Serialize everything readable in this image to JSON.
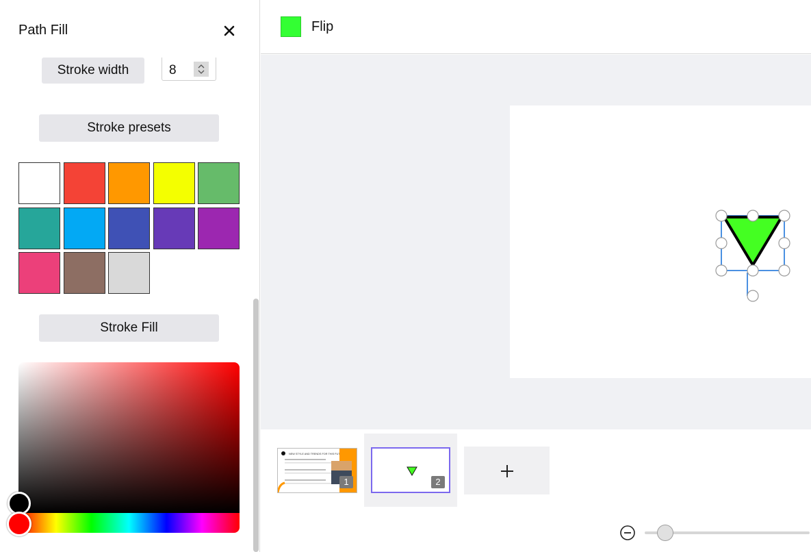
{
  "panel": {
    "title": "Path Fill",
    "stroke_width_label": "Stroke width",
    "stroke_width_value": "8",
    "stroke_presets_label": "Stroke presets",
    "stroke_fill_label": "Stroke Fill",
    "swatches": [
      "#ffffff",
      "#f44336",
      "#ff9800",
      "#f4ff00",
      "#66bb6a",
      "#26a69a",
      "#03a9f4",
      "#3f51b5",
      "#673ab7",
      "#9c27b0",
      "#ec407a",
      "#8d6e63",
      "#d9d9d9"
    ],
    "picker_selected_color": "#000000",
    "hue_selected_color": "#ff0000"
  },
  "toolbar": {
    "color_chip": "#33ff33",
    "flip_label": "Flip"
  },
  "canvas": {
    "shape": "triangle-down",
    "shape_fill": "#44ff22",
    "shape_stroke": "#000000",
    "selection_color": "#4a90e2"
  },
  "filmstrip": {
    "slides": [
      {
        "number": "1",
        "title": "NEW STYLE AND TRENDS FOR THIS FUTURE"
      },
      {
        "number": "2"
      }
    ]
  },
  "zoom": {
    "level": 0.1
  }
}
